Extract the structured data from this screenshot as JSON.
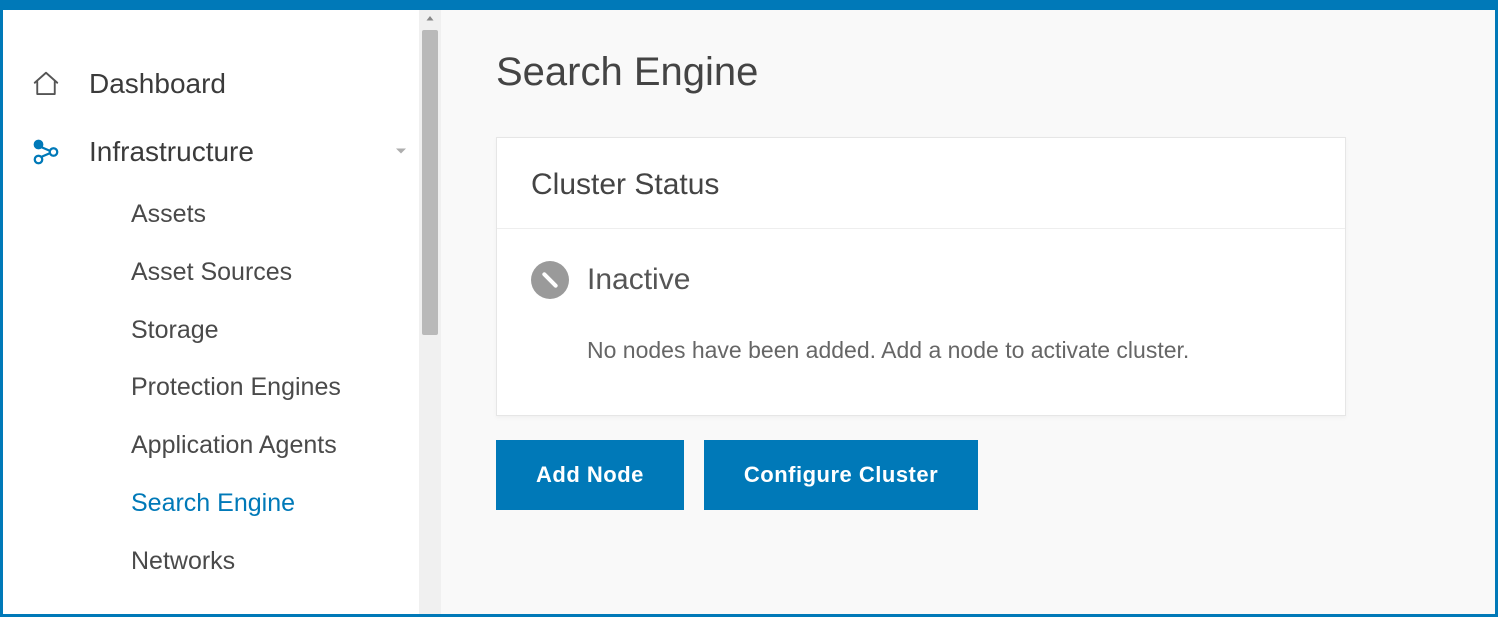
{
  "sidebar": {
    "top": [
      {
        "label": "Dashboard",
        "icon": "home-icon",
        "active": false,
        "expandable": false
      },
      {
        "label": "Infrastructure",
        "icon": "infrastructure-icon",
        "active": true,
        "expandable": true
      }
    ],
    "sub": [
      {
        "label": "Assets",
        "active": false
      },
      {
        "label": "Asset Sources",
        "active": false
      },
      {
        "label": "Storage",
        "active": false
      },
      {
        "label": "Protection Engines",
        "active": false
      },
      {
        "label": "Application Agents",
        "active": false
      },
      {
        "label": "Search Engine",
        "active": true
      },
      {
        "label": "Networks",
        "active": false
      }
    ]
  },
  "main": {
    "title": "Search Engine",
    "card": {
      "heading": "Cluster Status",
      "status_label": "Inactive",
      "status_desc": "No nodes have been added. Add a node to activate cluster."
    },
    "buttons": {
      "add_node": "Add Node",
      "configure_cluster": "Configure Cluster"
    }
  },
  "colors": {
    "primary": "#0079b8",
    "muted_icon": "#9a9a9a"
  }
}
